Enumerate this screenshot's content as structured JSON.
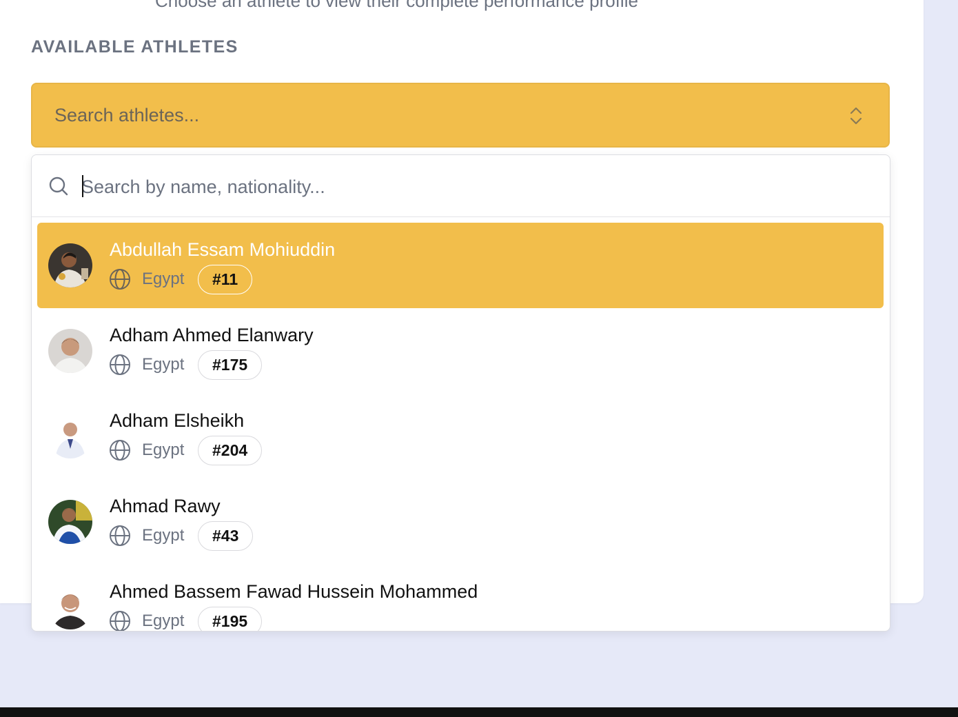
{
  "header": {
    "subtitle": "Choose an athlete to view their complete performance profile",
    "section_label": "AVAILABLE ATHLETES"
  },
  "combobox": {
    "placeholder": "Search athletes...",
    "icon": "chevron-up-down-icon"
  },
  "search": {
    "placeholder": "Search by name, nationality...",
    "value": "",
    "icon": "search-icon"
  },
  "athletes": [
    {
      "name": "Abdullah Essam Mohiuddin",
      "country": "Egypt",
      "rank": "#11",
      "selected": true
    },
    {
      "name": "Adham Ahmed Elanwary",
      "country": "Egypt",
      "rank": "#175",
      "selected": false
    },
    {
      "name": "Adham Elsheikh",
      "country": "Egypt",
      "rank": "#204",
      "selected": false
    },
    {
      "name": "Ahmad Rawy",
      "country": "Egypt",
      "rank": "#43",
      "selected": false
    },
    {
      "name": "Ahmed Bassem Fawad Hussein Mohammed",
      "country": "Egypt",
      "rank": "#195",
      "selected": false
    }
  ],
  "colors": {
    "accent": "#f2be4b",
    "background": "#e6e9f8"
  }
}
